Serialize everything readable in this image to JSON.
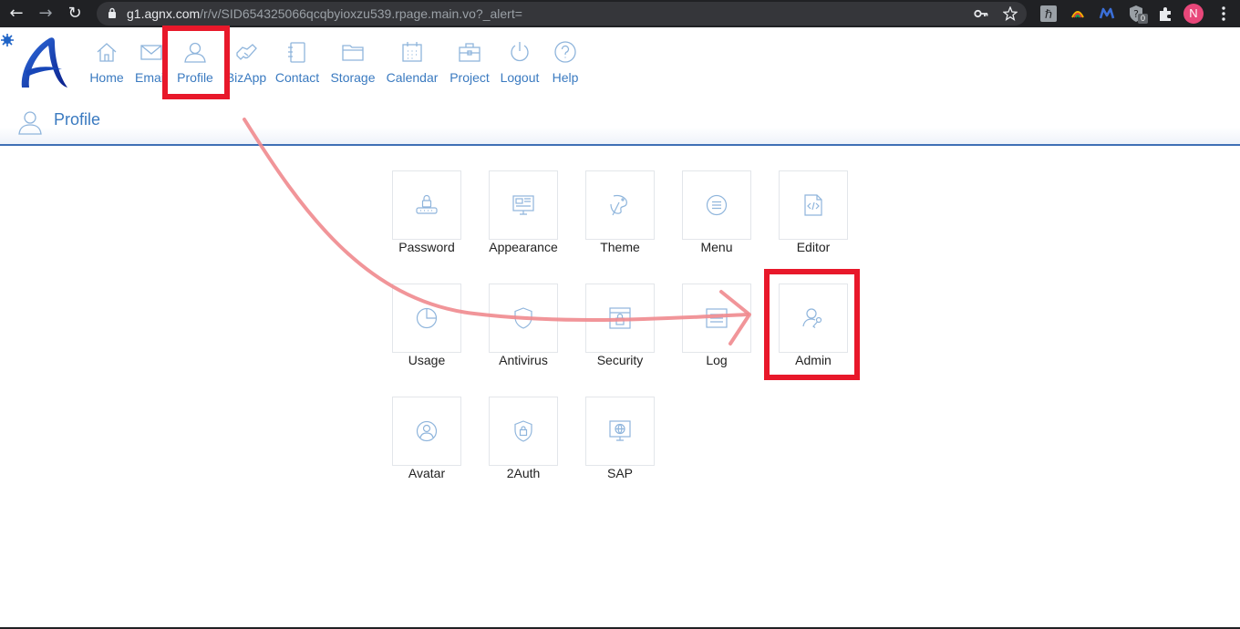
{
  "browser": {
    "url_host": "g1.agnx.com",
    "url_path": "/r/v/SID654325066qcqbyioxzu539.rpage.main.vo?_alert=",
    "profile_initial": "N",
    "extension_badge": "0"
  },
  "nav": {
    "items": [
      {
        "label": "Home",
        "icon": "home-icon"
      },
      {
        "label": "Email",
        "icon": "mail-icon"
      },
      {
        "label": "Profile",
        "icon": "user-icon"
      },
      {
        "label": "BizApp",
        "icon": "handshake-icon"
      },
      {
        "label": "Contact",
        "icon": "address-book-icon"
      },
      {
        "label": "Storage",
        "icon": "folder-icon"
      },
      {
        "label": "Calendar",
        "icon": "calendar-icon"
      },
      {
        "label": "Project",
        "icon": "briefcase-icon"
      },
      {
        "label": "Logout",
        "icon": "power-icon"
      },
      {
        "label": "Help",
        "icon": "help-icon"
      }
    ]
  },
  "page": {
    "title": "Profile"
  },
  "tiles": [
    {
      "label": "Password",
      "icon": "password-keypad-icon"
    },
    {
      "label": "Appearance",
      "icon": "layout-icon"
    },
    {
      "label": "Theme",
      "icon": "paint-icon"
    },
    {
      "label": "Menu",
      "icon": "menu-icon"
    },
    {
      "label": "Editor",
      "icon": "code-file-icon"
    },
    {
      "label": "Usage",
      "icon": "pie-chart-icon"
    },
    {
      "label": "Antivirus",
      "icon": "shield-icon"
    },
    {
      "label": "Security",
      "icon": "lock-window-icon"
    },
    {
      "label": "Log",
      "icon": "list-icon"
    },
    {
      "label": "Admin",
      "icon": "admin-user-icon"
    },
    {
      "label": "Avatar",
      "icon": "avatar-icon"
    },
    {
      "label": "2Auth",
      "icon": "shield-lock-icon"
    },
    {
      "label": "SAP",
      "icon": "monitor-globe-icon"
    }
  ],
  "colors": {
    "accent": "#3a7ac0",
    "highlight": "#e8182a",
    "arrow": "#f08a8e",
    "icon": "#8fb5dc"
  }
}
